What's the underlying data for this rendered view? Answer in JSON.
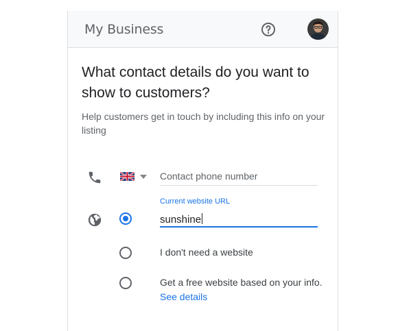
{
  "appbar": {
    "title": "My Business",
    "help_icon": "help-circle-icon",
    "avatar": "user-avatar"
  },
  "main": {
    "heading": "What contact details do you want to show to customers?",
    "subtext": "Help customers get in touch by including this info on your listing",
    "phone": {
      "icon": "phone-icon",
      "country_flag": "uk-flag-icon",
      "placeholder": "Contact phone number"
    },
    "website": {
      "icon": "globe-icon",
      "field_label": "Current website URL",
      "value": "sunshine"
    },
    "options": {
      "no_website": "I don't need a website",
      "free_website_text": "Get a free website based on your info.",
      "see_details_link": "See details"
    }
  },
  "colors": {
    "accent": "#1a73e8",
    "appbar_bg": "#f8f9fa",
    "text_primary": "#202124",
    "text_secondary": "#5f6368"
  }
}
